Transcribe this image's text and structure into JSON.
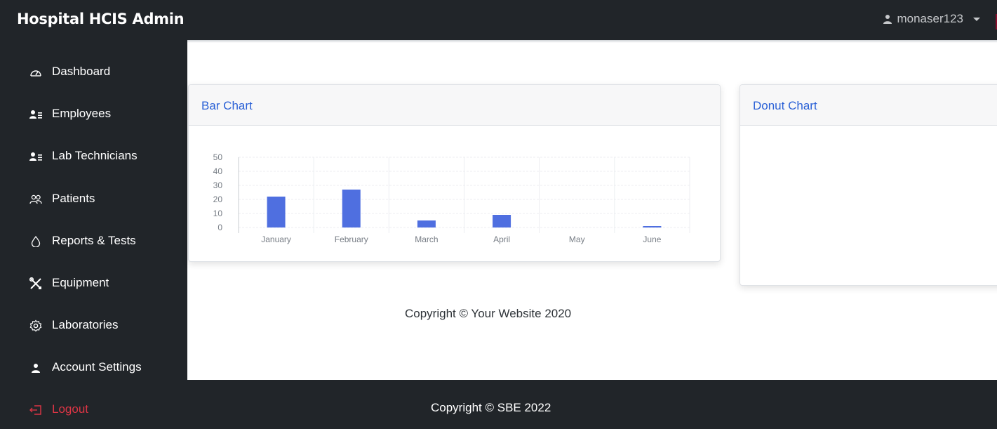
{
  "app": {
    "brand": "Hospital HCIS Admin"
  },
  "user_menu": {
    "username": "monaser123",
    "icon": "user-icon"
  },
  "sidebar": {
    "items": [
      {
        "label": "Dashboard",
        "icon": "speedometer-icon"
      },
      {
        "label": "Employees",
        "icon": "user-list-icon"
      },
      {
        "label": "Lab Technicians",
        "icon": "user-list-icon"
      },
      {
        "label": "Patients",
        "icon": "people-icon"
      },
      {
        "label": "Reports & Tests",
        "icon": "droplet-icon"
      },
      {
        "label": "Equipment",
        "icon": "tools-icon"
      },
      {
        "label": "Laboratories",
        "icon": "gear-icon"
      },
      {
        "label": "Account Settings",
        "icon": "user-icon"
      },
      {
        "label": "Logout",
        "icon": "logout-icon"
      }
    ]
  },
  "cards": {
    "bar": {
      "title": "Bar Chart"
    },
    "donut": {
      "title": "Donut Chart"
    }
  },
  "chart_data": {
    "type": "bar",
    "categories": [
      "January",
      "February",
      "March",
      "April",
      "May",
      "June"
    ],
    "values": [
      22,
      27,
      5,
      9,
      0,
      1
    ],
    "ylim": [
      0,
      50
    ],
    "yticks": [
      0,
      10,
      20,
      30,
      40,
      50
    ],
    "grid": true,
    "colors": {
      "bar": "#4f6fe0"
    }
  },
  "content_footer": {
    "text": "Copyright © Your Website 2020"
  },
  "page_footer": {
    "text": "Copyright © SBE 2022"
  },
  "colors": {
    "dark": "#212529",
    "accent": "#2b61d6",
    "logout": "#dc3545"
  }
}
